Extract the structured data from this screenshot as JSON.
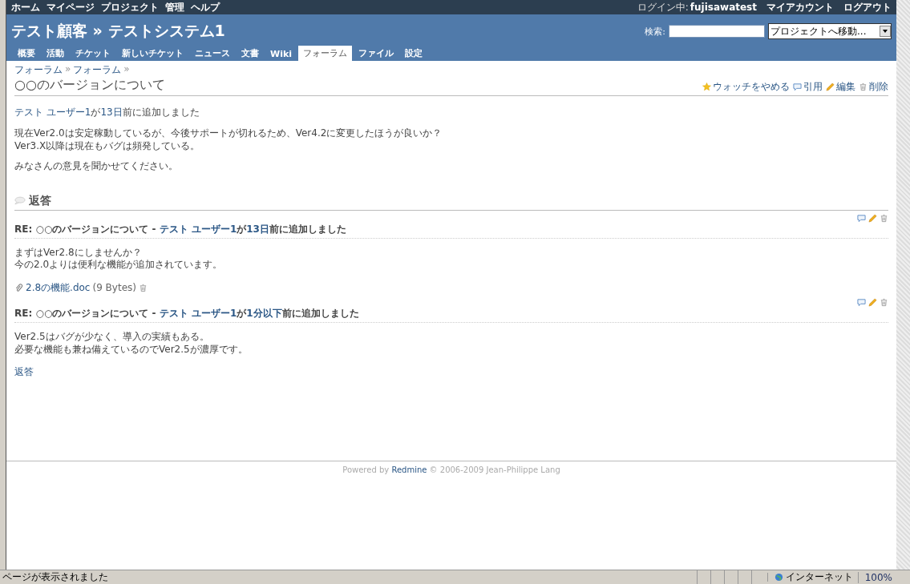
{
  "top_menu": [
    "ホーム",
    "マイページ",
    "プロジェクト",
    "管理",
    "ヘルプ"
  ],
  "login": {
    "label": "ログイン中:",
    "user": "fujisawatest"
  },
  "account_links": [
    "マイアカウント",
    "ログアウト"
  ],
  "header": {
    "title": "テスト顧客 » テストシステム1",
    "search_label": "検索:",
    "jump": "プロジェクトへ移動..."
  },
  "tabs": [
    {
      "label": "概要",
      "selected": false
    },
    {
      "label": "活動",
      "selected": false
    },
    {
      "label": "チケット",
      "selected": false
    },
    {
      "label": "新しいチケット",
      "selected": false
    },
    {
      "label": "ニュース",
      "selected": false
    },
    {
      "label": "文書",
      "selected": false
    },
    {
      "label": "Wiki",
      "selected": false
    },
    {
      "label": "フォーラム",
      "selected": true
    },
    {
      "label": "ファイル",
      "selected": false
    },
    {
      "label": "設定",
      "selected": false
    }
  ],
  "breadcrumb": [
    {
      "kind": "link",
      "text": "フォーラム"
    },
    {
      "kind": "sep",
      "text": "»"
    },
    {
      "kind": "link",
      "text": "フォーラム"
    },
    {
      "kind": "sep",
      "text": "»"
    }
  ],
  "topic": {
    "title": "○○のバージョンについて",
    "actions": [
      {
        "kind": "watch",
        "label": "ウォッチをやめる"
      },
      {
        "kind": "quote",
        "label": "引用"
      },
      {
        "kind": "edit",
        "label": "編集"
      },
      {
        "kind": "delete",
        "label": "削除"
      }
    ],
    "author": "テスト ユーザー1",
    "added_prefix": "が",
    "age": "13日",
    "added_suffix": "前に追加しました",
    "paragraphs": [
      [
        "現在Ver2.0は安定稼動しているが、今後サポートが切れるため、Ver4.2に変更したほうが良いか？",
        "Ver3.X以降は現在もバグは頻発している。"
      ],
      [
        "みなさんの意見を聞かせてください。"
      ]
    ]
  },
  "replies_heading": "返答",
  "replies": [
    {
      "subject": "RE: ○○のバージョンについて",
      "dash": "-",
      "author": "テスト ユーザー1",
      "added_prefix": "が",
      "age": "13日",
      "added_suffix": "前に追加しました",
      "body": [
        "まずはVer2.8にしませんか？",
        "今の2.0よりは便利な機能が追加されています。"
      ],
      "attachment": {
        "name": "2.8の機能.doc",
        "size": "(9 Bytes)"
      }
    },
    {
      "subject": "RE: ○○のバージョンについて",
      "dash": "-",
      "author": "テスト ユーザー1",
      "added_prefix": "が",
      "age": "1分以下",
      "added_suffix": "前に追加しました",
      "body": [
        "Ver2.5はバグが少なく、導入の実績もある。",
        "必要な機能も兼ね備えているのでVer2.5が濃厚です。"
      ]
    }
  ],
  "reply_link": "返答",
  "footer": {
    "prefix": "Powered by",
    "link": "Redmine",
    "suffix": "© 2006-2009 Jean-Philippe Lang"
  },
  "status_bar": {
    "message": "ページが表示されました",
    "zone": "インターネット",
    "zoom": "100%"
  }
}
